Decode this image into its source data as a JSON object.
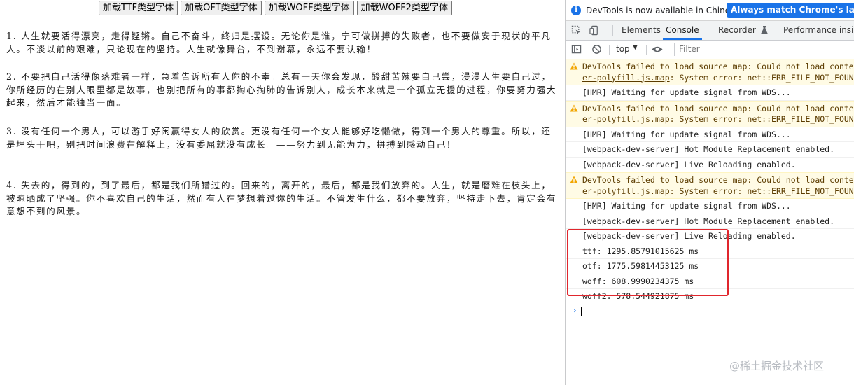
{
  "page": {
    "buttons": [
      "加载TTF类型字体",
      "加载OFT类型字体",
      "加载WOFF类型字体",
      "加载WOFF2类型字体"
    ],
    "paragraphs": [
      "1. 人生就要活得漂亮，走得铿锵。自己不奋斗，终归是摆设。无论你是谁，宁可做拼搏的失败者，也不要做安于现状的平凡人。不淡以前的艰难，只论现在的坚持。人生就像舞台，不到谢幕，永远不要认输！",
      "2. 不要把自己活得像落难者一样，急着告诉所有人你的不幸。总有一天你会发现，酸甜苦辣要自己尝，漫漫人生要自己过，你所经历的在别人眼里都是故事，也别把所有的事都掏心掏肺的告诉别人，成长本来就是一个孤立无援的过程，你要努力强大起来，然后才能独当一面。",
      "3. 没有任何一个男人，可以游手好闲赢得女人的欣赏。更没有任何一个女人能够好吃懒做，得到一个男人的尊重。所以，还是埋头干吧，别把时间浪费在解释上，没有委屈就没有成长。——努力到无能为力，拼搏到感动自己！",
      "4. 失去的，得到的，到了最后，都是我们所错过的。回来的，离开的，最后，都是我们放弃的。人生，就是磨难在枝头上，被晾晒成了坚强。你不喜欢自己的生活，然而有人在梦想着过你的生活。不管发生什么，都不要放弃，坚持走下去，肯定会有意想不到的风景。"
    ]
  },
  "devtools": {
    "infobar": {
      "text": "DevTools is now available in Chinese!",
      "button": "Always match Chrome's language"
    },
    "tabs": {
      "elements": "Elements",
      "console": "Console",
      "recorder": "Recorder",
      "performance": "Performance insigh"
    },
    "toolbar": {
      "context": "top",
      "filter_placeholder": "Filter"
    },
    "messages": [
      {
        "type": "warn",
        "line1": "DevTools failed to load source map: Could not load content",
        "link": "er-polyfill.js.map",
        "rest": ": System error: net::ERR_FILE_NOT_FOUND"
      },
      {
        "type": "info",
        "text": "[HMR] Waiting for update signal from WDS..."
      },
      {
        "type": "warn",
        "line1": "DevTools failed to load source map: Could not load content",
        "link": "er-polyfill.js.map",
        "rest": ": System error: net::ERR_FILE_NOT_FOUND"
      },
      {
        "type": "info",
        "text": "[HMR] Waiting for update signal from WDS..."
      },
      {
        "type": "info",
        "text": "[webpack-dev-server] Hot Module Replacement enabled."
      },
      {
        "type": "info",
        "text": "[webpack-dev-server] Live Reloading enabled."
      },
      {
        "type": "warn",
        "line1": "DevTools failed to load source map: Could not load content",
        "link": "er-polyfill.js.map",
        "rest": ": System error: net::ERR_FILE_NOT_FOUND"
      },
      {
        "type": "info",
        "text": "[HMR] Waiting for update signal from WDS..."
      },
      {
        "type": "info",
        "text": "[webpack-dev-server] Hot Module Replacement enabled."
      },
      {
        "type": "info",
        "text": "[webpack-dev-server] Live Reloading enabled."
      },
      {
        "type": "info",
        "text": "ttf: 1295.85791015625 ms"
      },
      {
        "type": "info",
        "text": "otf: 1775.59814453125 ms"
      },
      {
        "type": "info",
        "text": "woff: 608.9990234375 ms"
      },
      {
        "type": "info",
        "text": "woff2: 578.544921875 ms"
      }
    ]
  },
  "watermark": "@稀土掘金技术社区",
  "colors": {
    "accent": "#1a73e8",
    "warn_bg": "#fffbe5",
    "highlight": "#e0262d"
  }
}
